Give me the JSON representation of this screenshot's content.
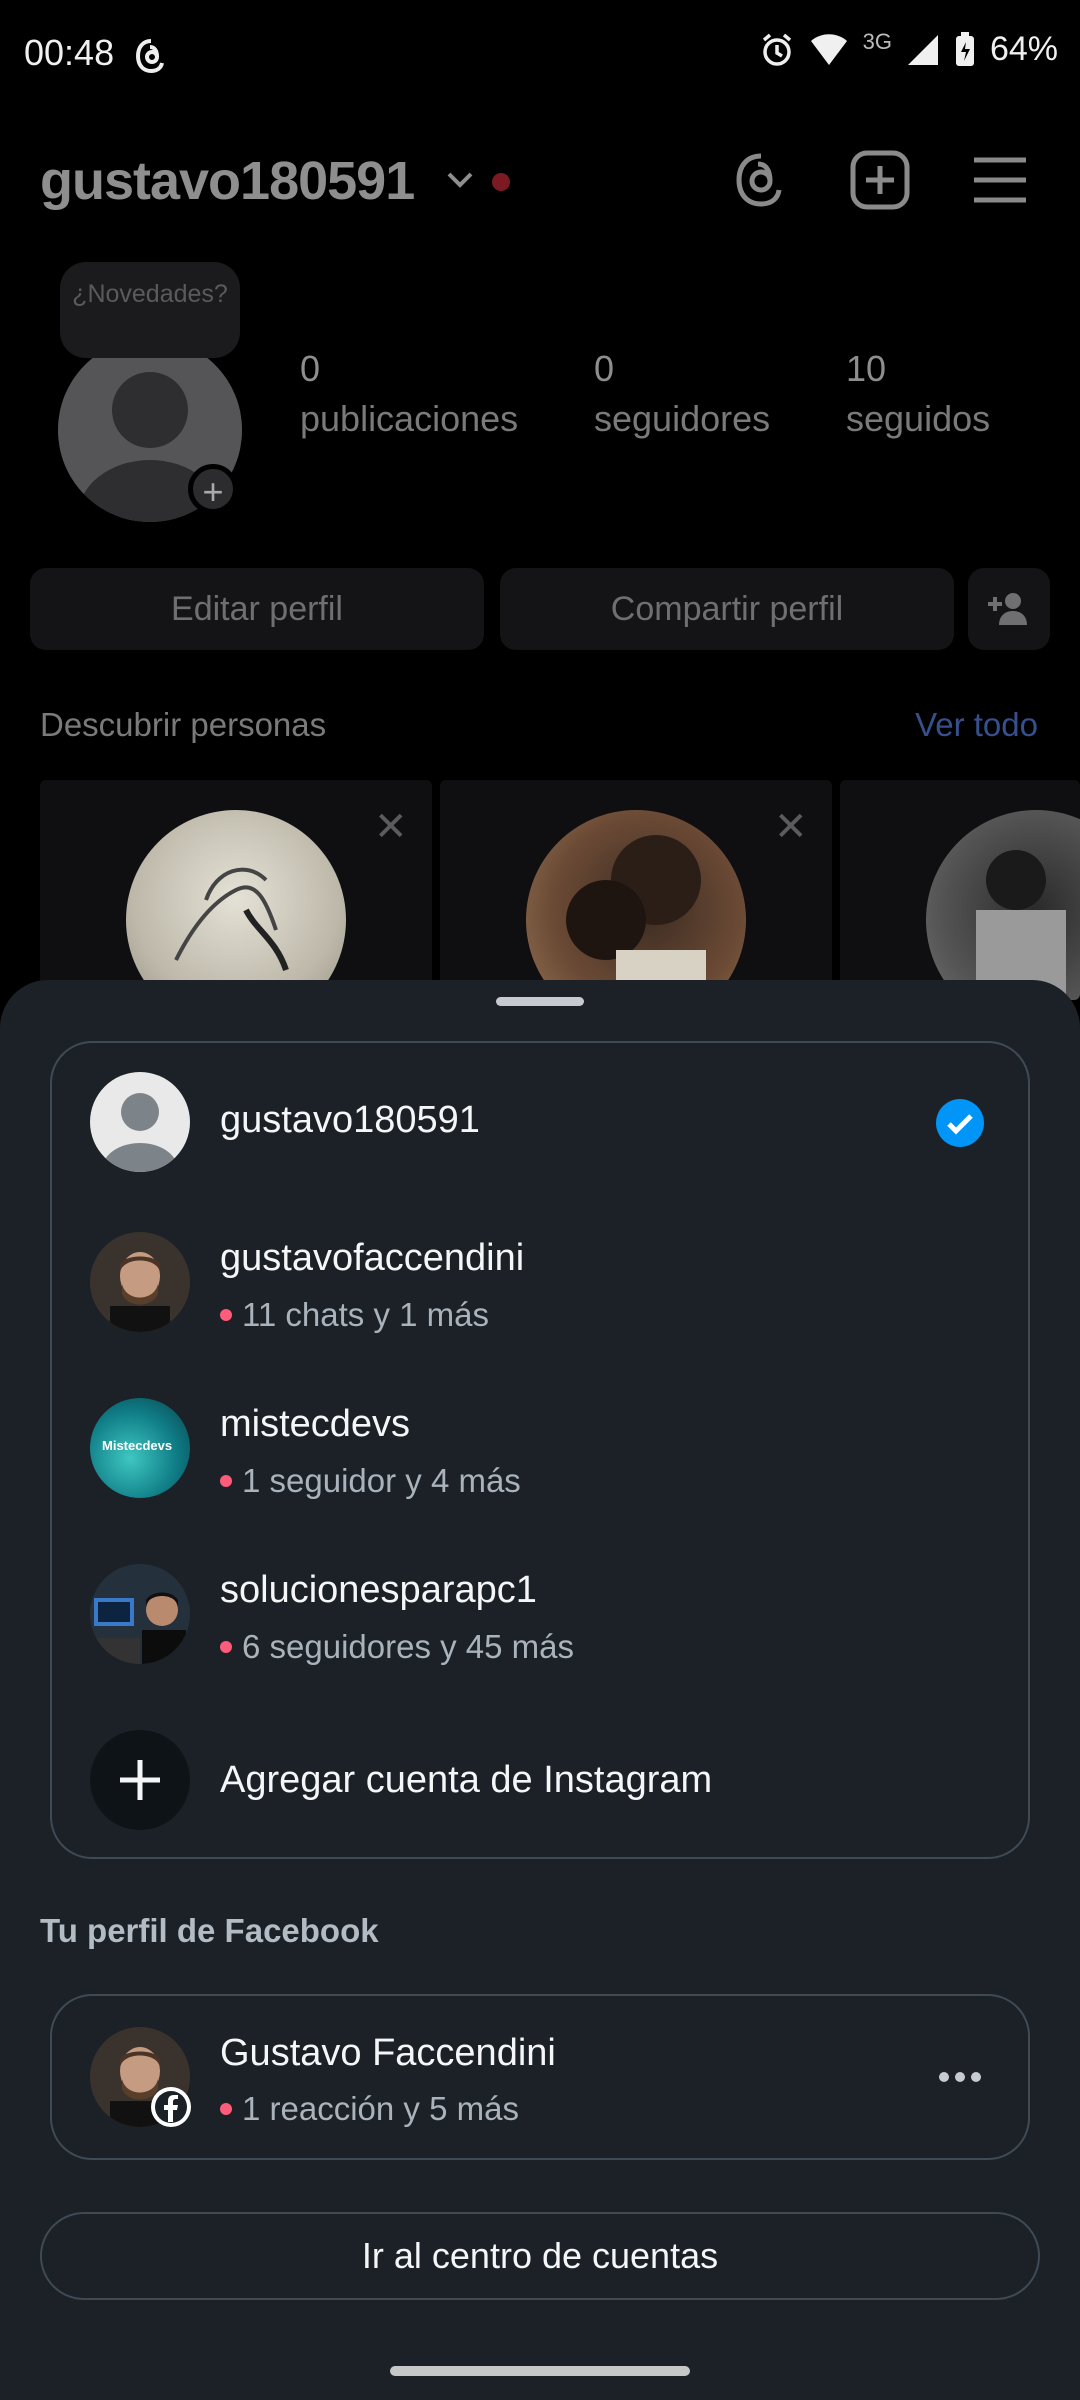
{
  "status_bar": {
    "time": "00:48",
    "network": "3G",
    "battery": "64%"
  },
  "profile": {
    "username": "gustavo180591",
    "note_placeholder": "¿Novedades?",
    "stats": [
      {
        "value": "0",
        "label": "publicaciones"
      },
      {
        "value": "0",
        "label": "seguidores"
      },
      {
        "value": "10",
        "label": "seguidos"
      }
    ],
    "buttons": {
      "edit": "Editar perfil",
      "share": "Compartir perfil"
    },
    "discover_title": "Descubrir personas",
    "see_all": "Ver todo"
  },
  "sheet": {
    "accounts": [
      {
        "username": "gustavo180591",
        "subtitle": "",
        "selected": true,
        "avatar": "default-avatar"
      },
      {
        "username": "gustavofaccendini",
        "subtitle": "11 chats y 1 más",
        "selected": false,
        "avatar": "photo-man-beard"
      },
      {
        "username": "mistecdevs",
        "subtitle": "1 seguidor y 4 más",
        "selected": false,
        "avatar": "mistecdevs-logo",
        "logo_text": "Mistecdevs"
      },
      {
        "username": "solucionesparapc1",
        "subtitle": "6 seguidores y 45 más",
        "selected": false,
        "avatar": "photo-desk-setup"
      }
    ],
    "add_account_label": "Agregar cuenta de Instagram",
    "facebook_section_title": "Tu perfil de Facebook",
    "facebook_profile": {
      "name": "Gustavo Faccendini",
      "subtitle": "1 reacción y 5 más"
    },
    "accounts_center_button": "Ir al centro de cuentas"
  },
  "colors": {
    "accent": "#0095f6",
    "sheet_bg": "#1b2127",
    "notification_dot": "#ff5b7a"
  }
}
